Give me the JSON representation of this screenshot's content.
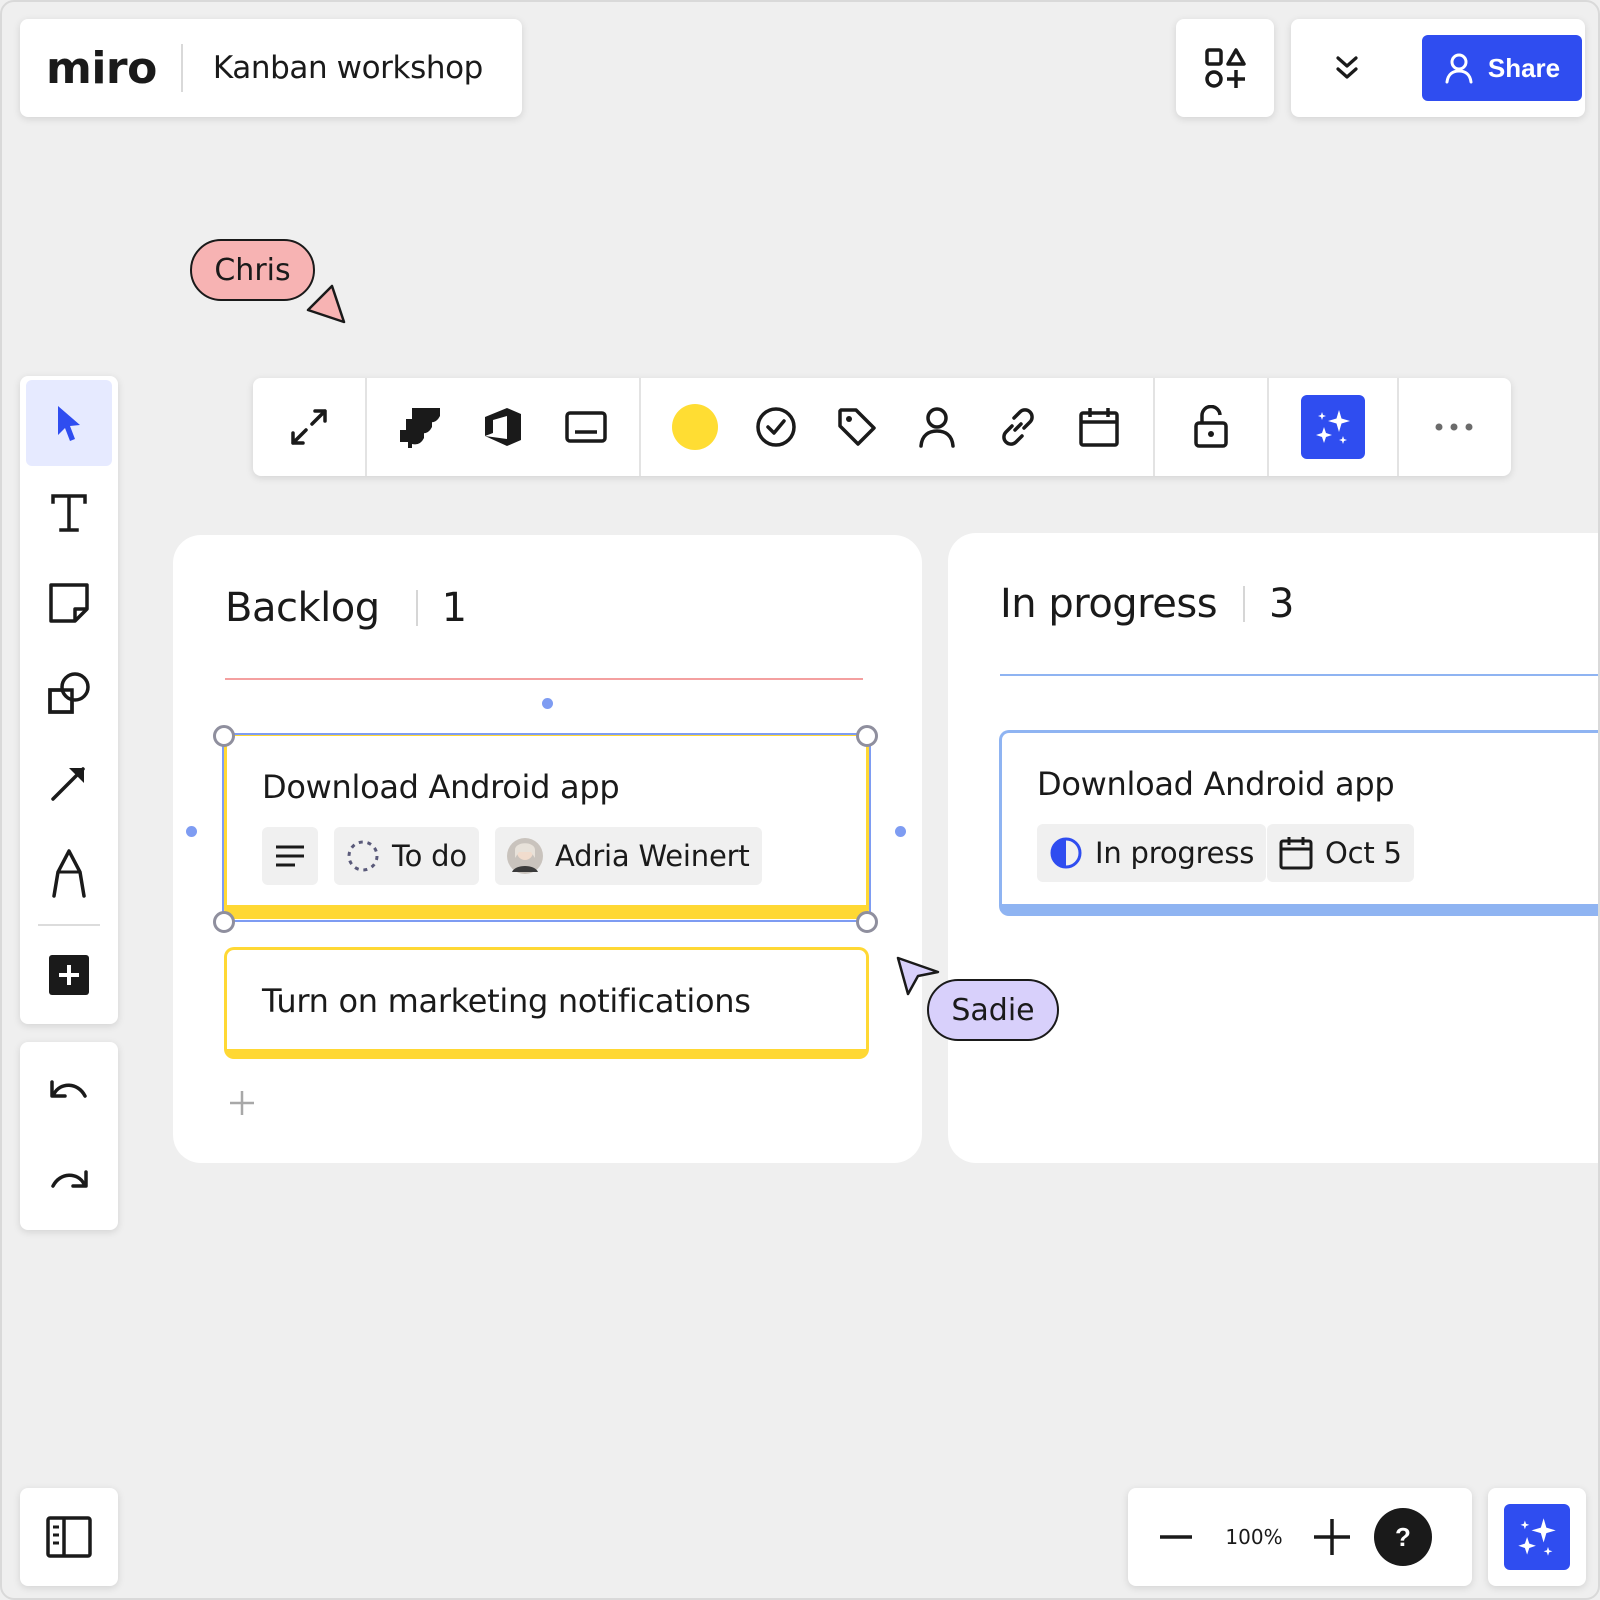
{
  "header": {
    "logo": "miro",
    "board_title": "Kanban workshop",
    "share_label": "Share"
  },
  "cursors": [
    {
      "name": "Chris",
      "color": "#f7b3b3"
    },
    {
      "name": "Sadie",
      "color": "#d8d0fb"
    }
  ],
  "left_toolbar": {
    "tools": [
      {
        "icon": "select-cursor-icon",
        "active": true
      },
      {
        "icon": "text-icon"
      },
      {
        "icon": "sticky-note-icon"
      },
      {
        "icon": "shapes-icon"
      },
      {
        "icon": "arrow-line-icon"
      },
      {
        "icon": "pen-icon"
      },
      {
        "icon": "add-more-icon"
      }
    ],
    "history": [
      "undo-icon",
      "redo-icon"
    ]
  },
  "context_toolbar": {
    "items": [
      "expand-icon",
      "jira-icon",
      "azure-devops-icon",
      "card-icon",
      "color-swatch",
      "status-icon",
      "tag-icon",
      "assignee-icon",
      "link-icon",
      "calendar-icon",
      "lock-icon",
      "ai-sparkle-icon",
      "more-icon"
    ],
    "swatch_color": "#ffdd33"
  },
  "columns": [
    {
      "title": "Backlog",
      "count": "1",
      "line_color": "#f4a0a0",
      "cards": [
        {
          "title": "Download Android app",
          "status": "To do",
          "assignee": "Adria Weinert",
          "border_color": "#ffd834",
          "selected": true
        },
        {
          "title": "Turn on marketing notifications",
          "border_color": "#ffd834"
        }
      ]
    },
    {
      "title": "In progress",
      "count": "3",
      "line_color": "#8fb4f2",
      "cards": [
        {
          "title": "Download Android app",
          "status": "In progress",
          "due_date": "Oct 5",
          "border_color": "#8fb4f2"
        }
      ]
    }
  ],
  "zoom": {
    "level": "100%",
    "help": "?"
  },
  "colors": {
    "accent": "#2f4df0",
    "canvas": "#efefef"
  }
}
